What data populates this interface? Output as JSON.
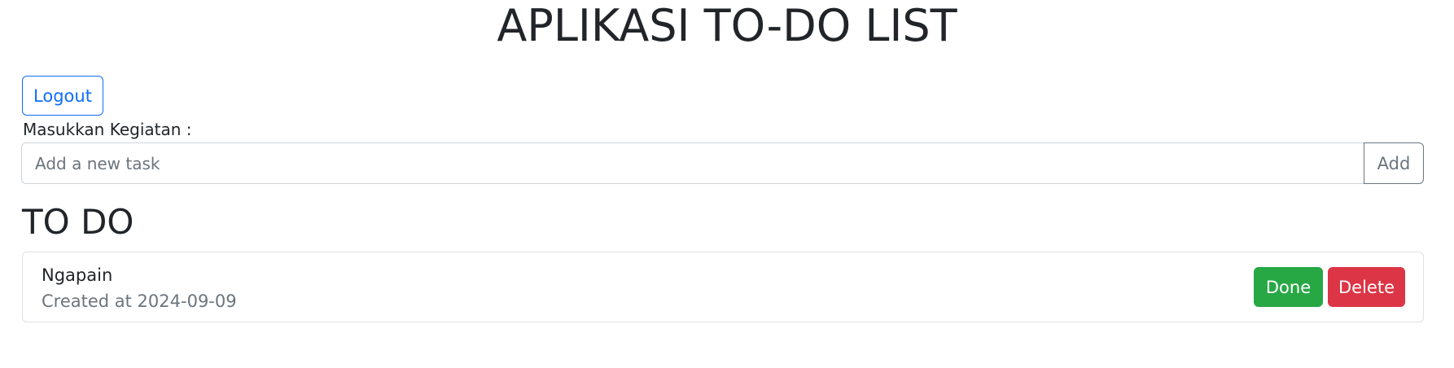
{
  "header": {
    "title": "APLIKASI TO-DO LIST"
  },
  "toolbar": {
    "logout_label": "Logout"
  },
  "form": {
    "label": "Masukkan Kegiatan :",
    "input_placeholder": "Add a new task",
    "input_value": "",
    "add_label": "Add"
  },
  "todo_section": {
    "title": "TO DO",
    "items": [
      {
        "name": "Ngapain",
        "created": "Created at 2024-09-09",
        "done_label": "Done",
        "delete_label": "Delete"
      }
    ]
  },
  "colors": {
    "primary": "#0d6efd",
    "secondary": "#6c757d",
    "success": "#28a745",
    "danger": "#dc3545",
    "text": "#212529",
    "border": "#dee2e6"
  }
}
